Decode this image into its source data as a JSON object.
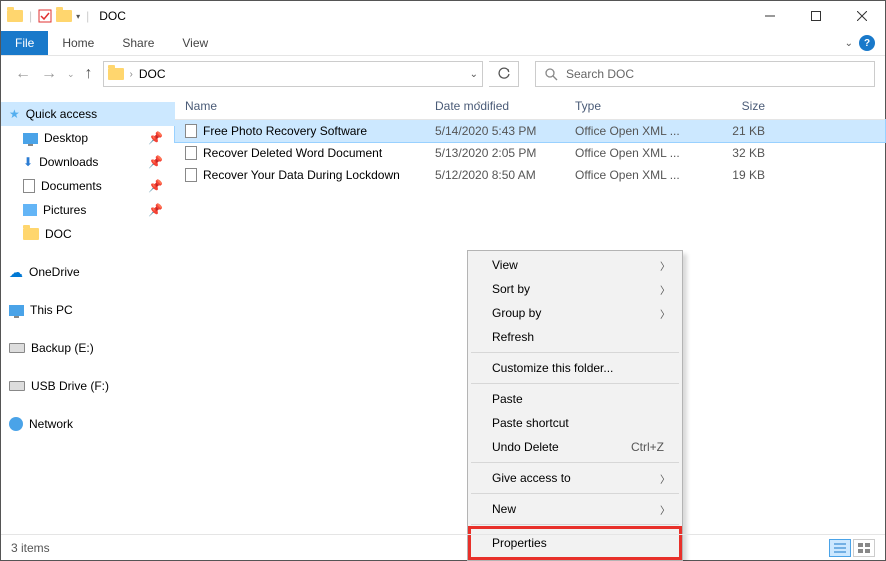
{
  "window": {
    "title": "DOC"
  },
  "ribbon": {
    "file": "File",
    "home": "Home",
    "share": "Share",
    "view": "View"
  },
  "address": {
    "path": "DOC",
    "search_placeholder": "Search DOC"
  },
  "sidebar": {
    "quick_access": "Quick access",
    "desktop": "Desktop",
    "downloads": "Downloads",
    "documents": "Documents",
    "pictures": "Pictures",
    "doc": "DOC",
    "onedrive": "OneDrive",
    "this_pc": "This PC",
    "backup": "Backup (E:)",
    "usb": "USB Drive (F:)",
    "network": "Network"
  },
  "columns": {
    "name": "Name",
    "date": "Date modified",
    "type": "Type",
    "size": "Size"
  },
  "files": [
    {
      "name": "Free Photo Recovery Software",
      "date": "5/14/2020 5:43 PM",
      "type": "Office Open XML ...",
      "size": "21 KB",
      "selected": true
    },
    {
      "name": "Recover Deleted Word Document",
      "date": "5/13/2020 2:05 PM",
      "type": "Office Open XML ...",
      "size": "32 KB",
      "selected": false
    },
    {
      "name": "Recover Your Data During Lockdown",
      "date": "5/12/2020 8:50 AM",
      "type": "Office Open XML ...",
      "size": "19 KB",
      "selected": false
    }
  ],
  "context_menu": {
    "view": "View",
    "sort_by": "Sort by",
    "group_by": "Group by",
    "refresh": "Refresh",
    "customize": "Customize this folder...",
    "paste": "Paste",
    "paste_shortcut": "Paste shortcut",
    "undo_delete": "Undo Delete",
    "undo_shortcut": "Ctrl+Z",
    "give_access": "Give access to",
    "new": "New",
    "properties": "Properties"
  },
  "status": {
    "items": "3 items"
  }
}
